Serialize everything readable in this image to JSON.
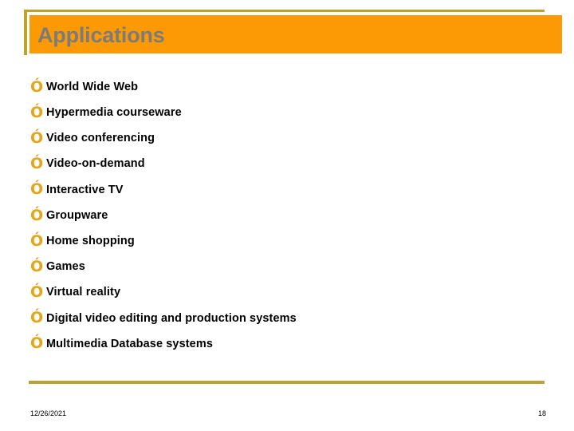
{
  "slide": {
    "title": "Applications",
    "bullet_marker": "Ó",
    "bullet_marker_icon": "ring-bullet-icon",
    "bullets": [
      {
        "label": "World Wide Web"
      },
      {
        "label": "Hypermedia courseware"
      },
      {
        "label": "Video conferencing"
      },
      {
        "label": "Video-on-demand"
      },
      {
        "label": "Interactive TV"
      },
      {
        "label": "Groupware"
      },
      {
        "label": "Home shopping"
      },
      {
        "label": "Games"
      },
      {
        "label": "Virtual reality"
      },
      {
        "label": "Digital video editing and production systems"
      },
      {
        "label": "Multimedia Database systems"
      }
    ],
    "footer": {
      "date": "12/26/2021",
      "page_number": "18"
    },
    "colors": {
      "banner_orange": "#fb9a05",
      "accent_gold": "#bfa22e",
      "title_text_gray": "#7b7b7b",
      "bullet_gold": "#e8a317",
      "body_text": "#000000",
      "background": "#ffffff"
    }
  }
}
